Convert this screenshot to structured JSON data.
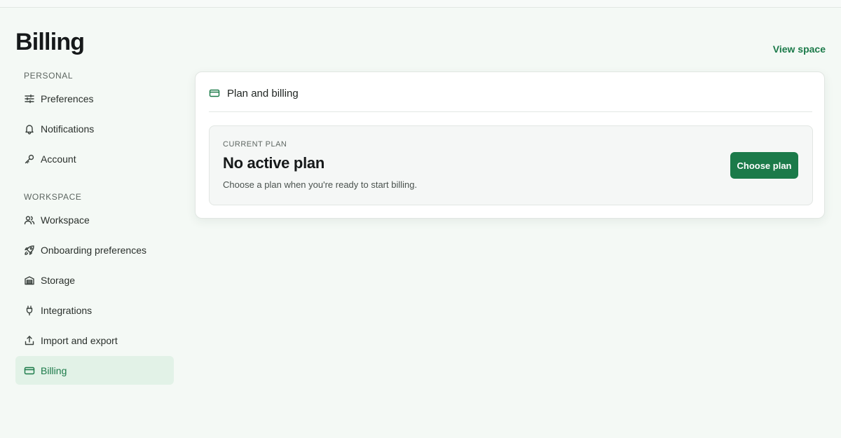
{
  "header": {
    "title": "Billing",
    "view_space_label": "View space"
  },
  "sidebar": {
    "personal_label": "PERSONAL",
    "personal_items": [
      {
        "label": "Preferences",
        "icon": "sliders-icon"
      },
      {
        "label": "Notifications",
        "icon": "bell-icon"
      },
      {
        "label": "Account",
        "icon": "key-icon"
      }
    ],
    "workspace_label": "WORKSPACE",
    "workspace_items": [
      {
        "label": "Workspace",
        "icon": "users-icon"
      },
      {
        "label": "Onboarding preferences",
        "icon": "rocket-icon"
      },
      {
        "label": "Storage",
        "icon": "storage-icon"
      },
      {
        "label": "Integrations",
        "icon": "plug-icon"
      },
      {
        "label": "Import and export",
        "icon": "upload-icon"
      },
      {
        "label": "Billing",
        "icon": "credit-card-icon",
        "active": true
      }
    ]
  },
  "card": {
    "title": "Plan and billing",
    "icon": "credit-card-icon",
    "current_plan_label": "CURRENT PLAN",
    "plan_name": "No active plan",
    "plan_description": "Choose a plan when you're ready to start billing.",
    "choose_button_label": "Choose plan"
  },
  "colors": {
    "accent": "#1b7a49",
    "background": "#f4f9f5",
    "active_bg": "#e2f2e7"
  }
}
